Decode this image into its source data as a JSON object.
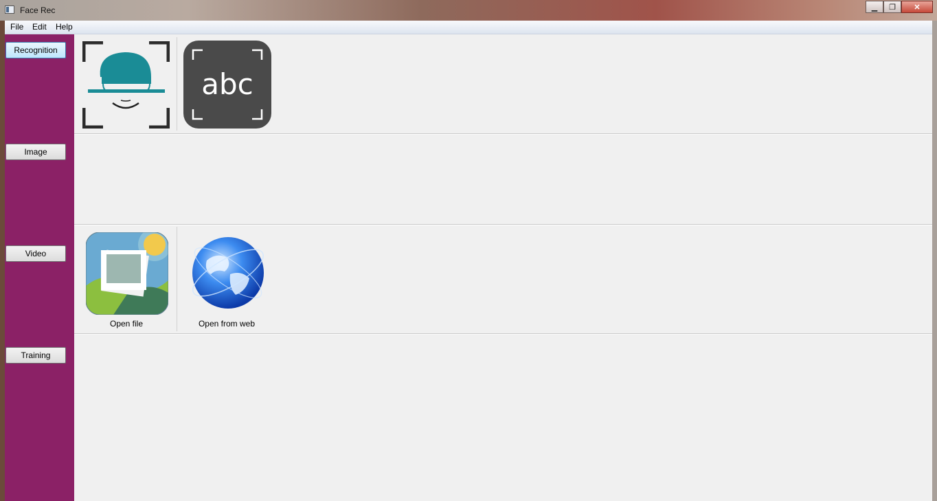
{
  "window": {
    "title": "Face Rec"
  },
  "menu": {
    "items": [
      "File",
      "Edit",
      "Help"
    ]
  },
  "sidebar": {
    "buttons": [
      {
        "label": "Recognition",
        "active": true
      },
      {
        "label": "Image",
        "active": false
      },
      {
        "label": "Video",
        "active": false
      },
      {
        "label": "Training",
        "active": false
      }
    ]
  },
  "recognition": {
    "text_icon_label": "abc"
  },
  "image_actions": [
    {
      "label": "Open file",
      "icon": "image-file-icon"
    },
    {
      "label": "Open from web",
      "icon": "globe-icon"
    }
  ],
  "colors": {
    "sidebar": "#8b2166",
    "content": "#f0f0f0",
    "face_teal": "#1a8c96"
  }
}
